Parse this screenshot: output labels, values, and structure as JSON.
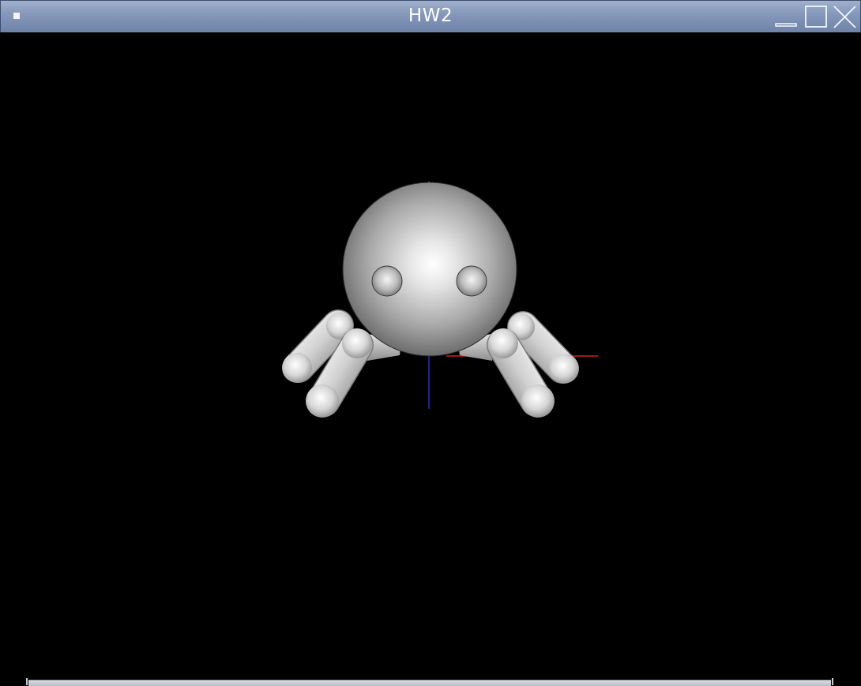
{
  "window": {
    "title": "HW2"
  },
  "icons": {
    "menu": "window-menu-icon",
    "minimize": "minimize-icon",
    "maximize": "maximize-icon",
    "close": "close-icon"
  },
  "colors": {
    "titlebar_top": "#9fb0cc",
    "titlebar_bottom": "#6f83a8",
    "viewport_background": "#000000",
    "axis_x": "#d02020",
    "axis_y": "#2030d0",
    "axis_z": "#c8c820",
    "model_highlight": "#ffffff",
    "model_shadow": "#3a3a3a"
  },
  "scene": {
    "model": "spider",
    "legs_per_side": 2
  }
}
